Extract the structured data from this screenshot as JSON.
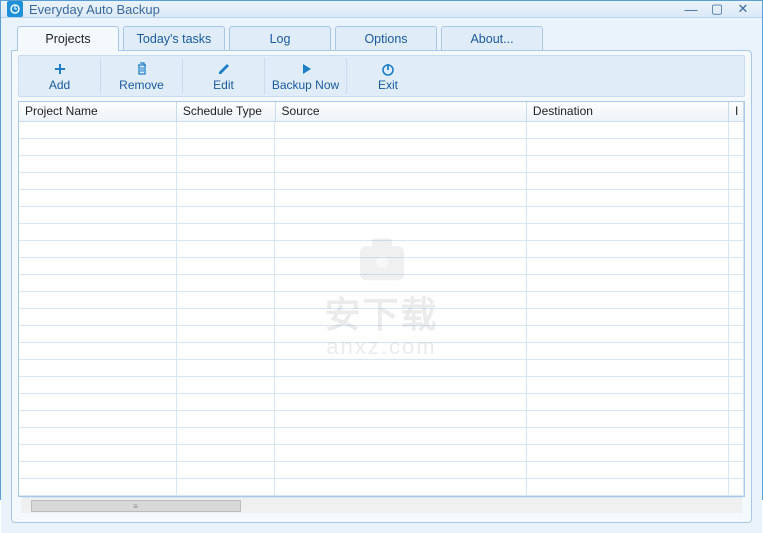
{
  "window": {
    "title": "Everyday Auto Backup"
  },
  "tabs": [
    {
      "label": "Projects",
      "active": true
    },
    {
      "label": "Today's tasks",
      "active": false
    },
    {
      "label": "Log",
      "active": false
    },
    {
      "label": "Options",
      "active": false
    },
    {
      "label": "About...",
      "active": false
    }
  ],
  "toolbar": {
    "add": "Add",
    "remove": "Remove",
    "edit": "Edit",
    "backup_now": "Backup Now",
    "exit": "Exit"
  },
  "table": {
    "columns": [
      "Project Name",
      "Schedule Type",
      "Source",
      "Destination",
      "I"
    ],
    "rows": []
  },
  "watermark": {
    "line1": "安下载",
    "line2": "anxz.com"
  }
}
